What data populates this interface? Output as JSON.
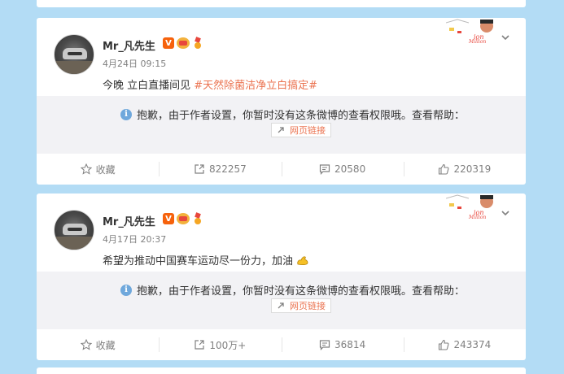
{
  "posts": [
    {
      "username": "Mr_凡先生",
      "verified": "V",
      "time": "4月24日 09:15",
      "text": "今晚 立白直播间见 ",
      "topic": "#天然除菌洁净立白搞定#",
      "notice": "抱歉，由于作者设置，你暂时没有这条微博的查看权限哦。查看帮助：",
      "link_label": "网页链接",
      "actions": {
        "collect": "收藏",
        "repost": "822257",
        "comment": "20580",
        "like": "220319"
      }
    },
    {
      "username": "Mr_凡先生",
      "verified": "V",
      "time": "4月17日 20:37",
      "text": "希望为推动中国赛车运动尽一份力，加油",
      "topic": "",
      "notice": "抱歉，由于作者设置，你暂时没有这条微博的查看权限哦。查看帮助：",
      "link_label": "网页链接",
      "actions": {
        "collect": "收藏",
        "repost": "100万+",
        "comment": "36814",
        "like": "243374"
      }
    }
  ],
  "colors": {
    "background": "#b3dcf5",
    "accent": "#eb7350",
    "vip": "#f6620c"
  },
  "icons": [
    "star-icon",
    "repost-icon",
    "comment-icon",
    "like-icon",
    "chevron-down-icon",
    "info-icon",
    "link-icon",
    "muscle-emoji-icon"
  ]
}
